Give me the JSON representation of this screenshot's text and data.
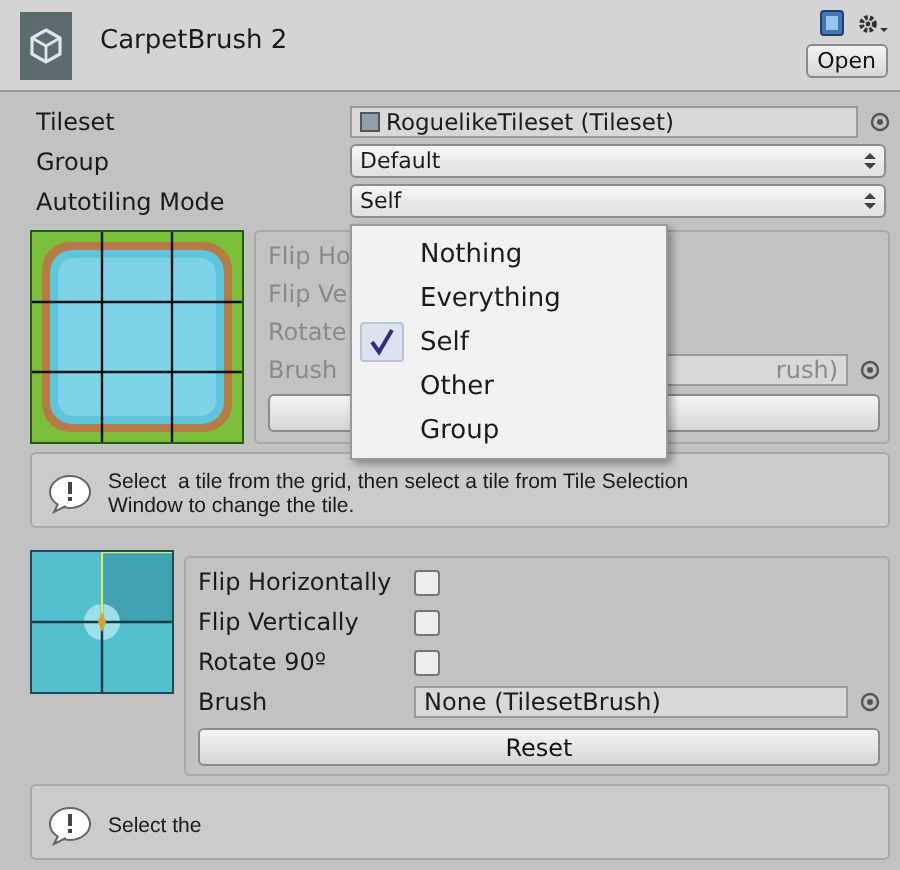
{
  "header": {
    "title": "CarpetBrush 2",
    "open_button": "Open"
  },
  "fields": [
    {
      "label": "Tileset",
      "kind": "object",
      "value": "RoguelikeTileset (Tileset)"
    },
    {
      "label": "Group",
      "kind": "popup",
      "value": "Default"
    },
    {
      "label": "Autotiling Mode",
      "kind": "popup",
      "value": "Self"
    }
  ],
  "autotiling_menu": {
    "options": [
      {
        "label": "Nothing",
        "selected": false
      },
      {
        "label": "Everything",
        "selected": false
      },
      {
        "label": "Self",
        "selected": true
      },
      {
        "label": "Other",
        "selected": false
      },
      {
        "label": "Group",
        "selected": false
      }
    ]
  },
  "tile_editor": {
    "rows": [
      {
        "kind": "text",
        "label": "Flip Ho"
      },
      {
        "kind": "text",
        "label": "Flip Ve"
      },
      {
        "kind": "text",
        "label": "Rotate"
      },
      {
        "kind": "object",
        "label": "Brush",
        "value": "rush)"
      }
    ],
    "help": "Select  a tile from the grid, then select a tile from Tile Selection Window to change the tile."
  },
  "interior_editor": {
    "rows": [
      {
        "kind": "checkbox",
        "label": "Flip Horizontally",
        "checked": false
      },
      {
        "kind": "checkbox",
        "label": "Flip Vertically",
        "checked": false
      },
      {
        "kind": "checkbox",
        "label": "Rotate 90º",
        "checked": false
      },
      {
        "kind": "object",
        "label": "Brush",
        "value": "None (TilesetBrush)"
      }
    ],
    "button": "Reset",
    "help": "Select the"
  }
}
